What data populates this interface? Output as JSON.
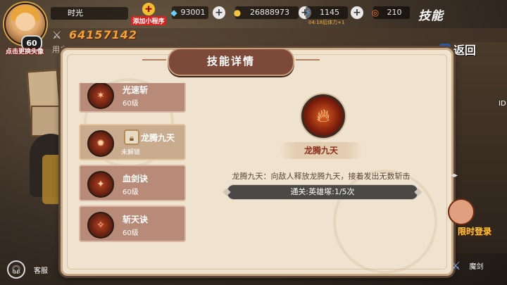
{
  "profile": {
    "level": "60",
    "change_avatar_label": "点击更换头像",
    "name": "时光",
    "power": "64157142",
    "user_label": "用户"
  },
  "mini_program": {
    "label": "添加小程序"
  },
  "resources": [
    {
      "icon": "diamond-icon",
      "value": "93001"
    },
    {
      "icon": "gold-coin-icon",
      "value": "26888973"
    },
    {
      "icon": "stamina-icon",
      "value": "1145",
      "sub": "04:18后体力+1"
    },
    {
      "icon": "token-icon",
      "value": "210"
    }
  ],
  "page_title": "技能",
  "back_label": "返回",
  "dialog": {
    "title": "技能详情",
    "skills": [
      {
        "name": "光速斩",
        "level": "60级",
        "locked": false
      },
      {
        "name": "龙腾九天",
        "level": "",
        "locked": true,
        "status": "未解锁"
      },
      {
        "name": "血剑诀",
        "level": "60级",
        "locked": false
      },
      {
        "name": "斩天诀",
        "level": "60级",
        "locked": false
      }
    ],
    "detail": {
      "name": "龙腾九天",
      "description": "龙腾九天：向敌人释放龙腾九天，接着发出无数斩击",
      "progress_text": "通关:英雄塚:1/5次"
    }
  },
  "bottom": {
    "service_label": "客服",
    "sword_label": "魔剑",
    "limited_label": "限时登录"
  },
  "side": {
    "id_text": "ID"
  },
  "colors": {
    "accent": "#f0a23a",
    "panel_bg": "#efe3d0",
    "header_tab": "#7d4a3a",
    "skill_name": "#8a2e1c"
  }
}
